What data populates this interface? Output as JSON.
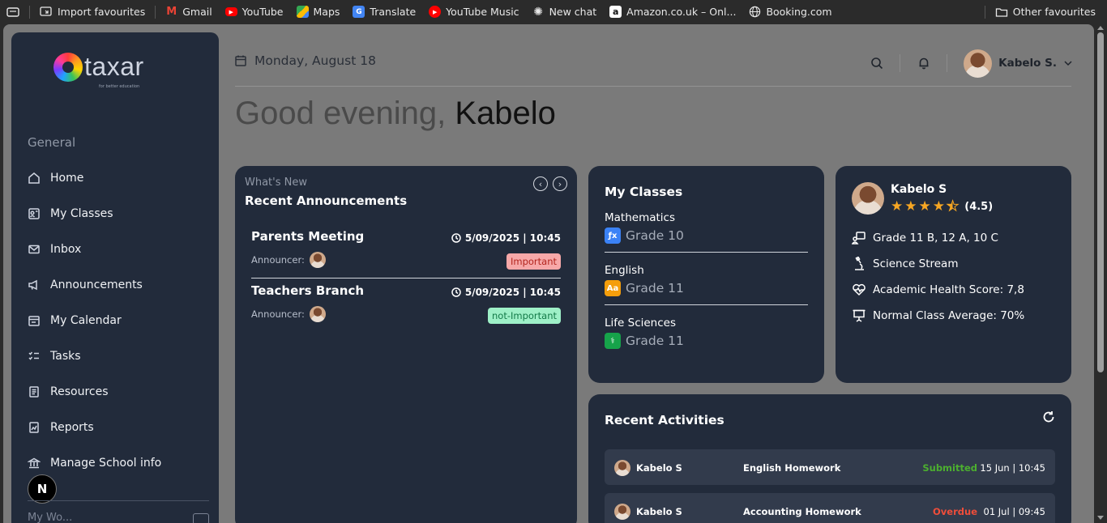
{
  "bookmarks": {
    "items": [
      {
        "label": "Import favourites",
        "icon": "import-icon"
      },
      {
        "label": "Gmail",
        "icon": "gmail-icon"
      },
      {
        "label": "YouTube",
        "icon": "youtube-icon"
      },
      {
        "label": "Maps",
        "icon": "maps-icon"
      },
      {
        "label": "Translate",
        "icon": "translate-icon"
      },
      {
        "label": "YouTube Music",
        "icon": "youtube-music-icon"
      },
      {
        "label": "New chat",
        "icon": "chat-icon"
      },
      {
        "label": "Amazon.co.uk – Onl...",
        "icon": "amazon-icon"
      },
      {
        "label": "Booking.com",
        "icon": "globe-icon"
      }
    ],
    "other": "Other favourites"
  },
  "sidebar": {
    "logo_text": "taxar",
    "logo_tagline": "for better education",
    "heading": "General",
    "items": [
      {
        "label": "Home",
        "icon": "home-icon"
      },
      {
        "label": "My Classes",
        "icon": "classes-icon"
      },
      {
        "label": "Inbox",
        "icon": "inbox-icon"
      },
      {
        "label": "Announcements",
        "icon": "megaphone-icon"
      },
      {
        "label": "My Calendar",
        "icon": "calendar-icon"
      },
      {
        "label": "Tasks",
        "icon": "tasks-icon"
      },
      {
        "label": "Resources",
        "icon": "resources-icon"
      },
      {
        "label": "Reports",
        "icon": "reports-icon"
      },
      {
        "label": "Manage School info",
        "icon": "school-icon"
      }
    ],
    "cut_label": "My Wo...",
    "next_badge": "N"
  },
  "header": {
    "date": "Monday, August 18",
    "user_name": "Kabelo S."
  },
  "greeting": {
    "prefix": "Good evening,",
    "name": "Kabelo"
  },
  "announcements": {
    "kicker": "What's New",
    "title": "Recent Announcements",
    "items": [
      {
        "title": "Parents Meeting",
        "datetime": "5/09/2025 | 10:45",
        "announcer_label": "Announcer:",
        "badge": "Important",
        "badge_bg": "#f7a8a8",
        "badge_fg": "#b3261e"
      },
      {
        "title": "Teachers Branch",
        "datetime": "5/09/2025 | 10:45",
        "announcer_label": "Announcer:",
        "badge": "not-Important",
        "badge_bg": "#9ef0c7",
        "badge_fg": "#137a48"
      }
    ]
  },
  "classes": {
    "title": "My Classes",
    "items": [
      {
        "subject": "Mathematics",
        "grade": "Grade 10",
        "icon_text": "ƒx",
        "color": "#3b82f6"
      },
      {
        "subject": "English",
        "grade": "Grade 11",
        "icon_text": "Aa",
        "color": "#f59e0b"
      },
      {
        "subject": "Life Sciences",
        "grade": "Grade 11",
        "icon_text": "⚕",
        "color": "#16a34a"
      }
    ]
  },
  "profile": {
    "name": "Kabelo S",
    "rating": "(4.5)",
    "stars_value": 4.5,
    "info": [
      {
        "text": "Grade 11 B, 12 A, 10 C",
        "icon": "classroom-icon"
      },
      {
        "text": "Science Stream",
        "icon": "microscope-icon"
      },
      {
        "text": "Academic Health Score: 7,8",
        "icon": "heart-pulse-icon"
      },
      {
        "text": "Normal Class Average: 70%",
        "icon": "presentation-icon"
      }
    ]
  },
  "activities": {
    "title": "Recent Activities",
    "rows": [
      {
        "name": "Kabelo S",
        "task": "English Homework",
        "status": "Submitted",
        "status_color": "#4caf2f",
        "when": "15 Jun | 10:45"
      },
      {
        "name": "Kabelo S",
        "task": "Accounting Homework",
        "status": "Overdue",
        "status_color": "#ef4d3a",
        "when": "01 Jul | 09:45"
      }
    ]
  }
}
